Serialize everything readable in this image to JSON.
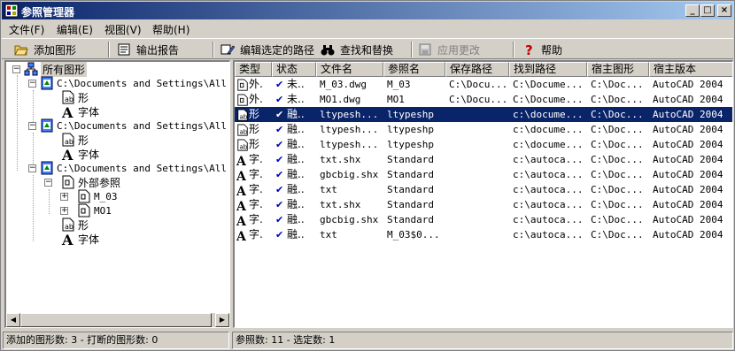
{
  "window": {
    "title": "参照管理器",
    "min_glyph": "_",
    "max_glyph": "□",
    "close_glyph": "×"
  },
  "menu": [
    "文件(F)",
    "编辑(E)",
    "视图(V)",
    "帮助(H)"
  ],
  "toolbar": {
    "add_drawing": "添加图形",
    "export_report": "输出报告",
    "edit_path": "编辑选定的路径",
    "find_replace": "查找和替换",
    "apply_changes": "应用更改",
    "help": "帮助"
  },
  "tree": {
    "root": "所有图形",
    "drawing1": "C:\\Documents and Settings\\All Us",
    "drawing2": "C:\\Documents and Settings\\All Us",
    "drawing3": "C:\\Documents and Settings\\All Us",
    "shape": "形",
    "font": "字体",
    "xref": "外部参照",
    "m03": "M_03",
    "m01": "MO1"
  },
  "columns": [
    "类型",
    "状态",
    "文件名",
    "参照名",
    "保存路径",
    "找到路径",
    "宿主图形",
    "宿主版本"
  ],
  "rows": [
    {
      "type": "外.",
      "icon": "xref-icon",
      "status": "未..",
      "file": "M_03.dwg",
      "ref": "M_03",
      "save": "C:\\Docu...",
      "found": "C:\\Docume...",
      "host": "C:\\Doc...",
      "ver": "AutoCAD 2004"
    },
    {
      "type": "外.",
      "icon": "xref-icon",
      "status": "未..",
      "file": "MO1.dwg",
      "ref": "MO1",
      "save": "C:\\Docu...",
      "found": "C:\\Docume...",
      "host": "C:\\Doc...",
      "ver": "AutoCAD 2004"
    },
    {
      "type": "形",
      "icon": "shape-icon",
      "status": "融..",
      "file": "ltypesh...",
      "ref": "ltypeshp",
      "save": "",
      "found": "c:\\docume...",
      "host": "C:\\Doc...",
      "ver": "AutoCAD 2004",
      "selected": true
    },
    {
      "type": "形",
      "icon": "shape-icon",
      "status": "融..",
      "file": "ltypesh...",
      "ref": "ltypeshp",
      "save": "",
      "found": "c:\\docume...",
      "host": "C:\\Doc...",
      "ver": "AutoCAD 2004"
    },
    {
      "type": "形",
      "icon": "shape-icon",
      "status": "融..",
      "file": "ltypesh...",
      "ref": "ltypeshp",
      "save": "",
      "found": "c:\\docume...",
      "host": "C:\\Doc...",
      "ver": "AutoCAD 2004"
    },
    {
      "type": "字.",
      "icon": "font-icon",
      "status": "融..",
      "file": "txt.shx",
      "ref": "Standard",
      "save": "",
      "found": "c:\\autoca...",
      "host": "C:\\Doc...",
      "ver": "AutoCAD 2004"
    },
    {
      "type": "字.",
      "icon": "font-icon",
      "status": "融..",
      "file": "gbcbig.shx",
      "ref": "Standard",
      "save": "",
      "found": "c:\\autoca...",
      "host": "C:\\Doc...",
      "ver": "AutoCAD 2004"
    },
    {
      "type": "字.",
      "icon": "font-icon",
      "status": "融..",
      "file": "txt",
      "ref": "Standard",
      "save": "",
      "found": "c:\\autoca...",
      "host": "C:\\Doc...",
      "ver": "AutoCAD 2004"
    },
    {
      "type": "字.",
      "icon": "font-icon",
      "status": "融..",
      "file": "txt.shx",
      "ref": "Standard",
      "save": "",
      "found": "c:\\autoca...",
      "host": "C:\\Doc...",
      "ver": "AutoCAD 2004"
    },
    {
      "type": "字.",
      "icon": "font-icon",
      "status": "融..",
      "file": "gbcbig.shx",
      "ref": "Standard",
      "save": "",
      "found": "c:\\autoca...",
      "host": "C:\\Doc...",
      "ver": "AutoCAD 2004"
    },
    {
      "type": "字.",
      "icon": "font-icon",
      "status": "融..",
      "file": "txt",
      "ref": "M_03$0...",
      "save": "",
      "found": "c:\\autoca...",
      "host": "C:\\Doc...",
      "ver": "AutoCAD 2004"
    }
  ],
  "status": {
    "left": "添加的图形数: 3  -  打断的图形数: 0",
    "right": "参照数: 11  -  选定数: 1"
  },
  "colors": {
    "selection": "#0a246a",
    "title_start": "#0a246a",
    "title_end": "#a6caf0"
  }
}
